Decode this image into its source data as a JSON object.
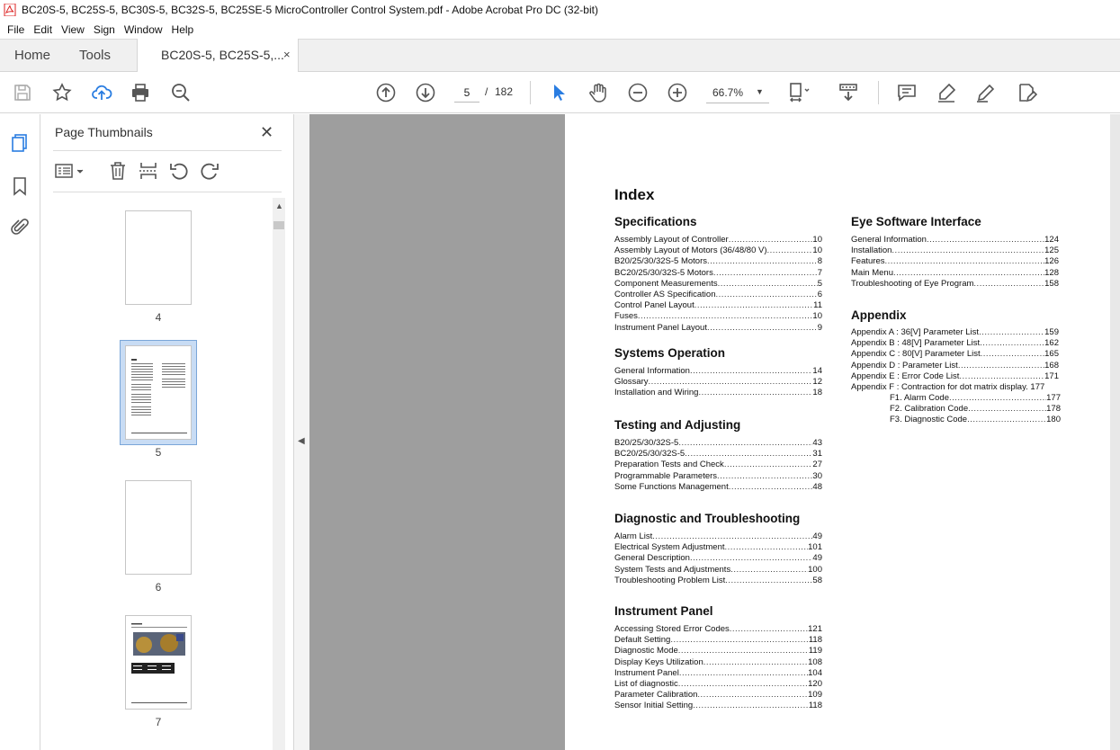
{
  "window": {
    "title": "BC20S-5, BC25S-5, BC30S-5, BC32S-5, BC25SE-5 MicroController Control System.pdf - Adobe Acrobat Pro DC (32-bit)"
  },
  "menu": [
    "File",
    "Edit",
    "View",
    "Sign",
    "Window",
    "Help"
  ],
  "tabs": {
    "home": "Home",
    "tools": "Tools",
    "doc": "BC20S-5, BC25S-5,...",
    "close": "×"
  },
  "toolbar": {
    "page_current": "5",
    "page_sep": "/",
    "page_total": "182",
    "zoom": "66.7%"
  },
  "thumbs": {
    "title": "Page Thumbnails",
    "pages": [
      {
        "num": "4"
      },
      {
        "num": "5"
      },
      {
        "num": "6"
      },
      {
        "num": "7"
      }
    ]
  },
  "doc": {
    "index_title": "Index",
    "left": [
      {
        "head": "Specifications",
        "entries": [
          [
            "Assembly Layout of Controller",
            "10"
          ],
          [
            "Assembly Layout of Motors (36/48/80 V)",
            "10"
          ],
          [
            "B20/25/30/32S-5 Motors",
            "8"
          ],
          [
            "BC20/25/30/32S-5 Motors",
            "7"
          ],
          [
            "Component Measurements",
            "5"
          ],
          [
            "Controller AS Specification",
            "6"
          ],
          [
            "Control Panel Layout",
            "11"
          ],
          [
            "Fuses",
            "10"
          ],
          [
            "Instrument Panel Layout",
            "9"
          ]
        ]
      },
      {
        "head": "Systems Operation",
        "entries": [
          [
            "General Information",
            "14"
          ],
          [
            "Glossary",
            "12"
          ],
          [
            "Installation and Wiring",
            "18"
          ]
        ]
      },
      {
        "head": "Testing and Adjusting",
        "entries": [
          [
            "B20/25/30/32S-5",
            "43"
          ],
          [
            "BC20/25/30/32S-5",
            "31"
          ],
          [
            "Preparation Tests and Check",
            "27"
          ],
          [
            "Programmable Parameters",
            "30"
          ],
          [
            "Some Functions Management",
            "48"
          ]
        ]
      },
      {
        "head": "Diagnostic and Troubleshooting",
        "entries": [
          [
            "Alarm List",
            "49"
          ],
          [
            "Electrical System Adjustment",
            "101"
          ],
          [
            "General Description",
            "49"
          ],
          [
            "System Tests and Adjustments",
            "100"
          ],
          [
            "Troubleshooting Problem List",
            "58"
          ]
        ]
      },
      {
        "head": "Instrument Panel",
        "entries": [
          [
            "Accessing Stored Error Codes",
            "121"
          ],
          [
            "Default Setting",
            "118"
          ],
          [
            "Diagnostic Mode",
            "119"
          ],
          [
            "Display Keys Utilization",
            "108"
          ],
          [
            "Instrument Panel",
            "104"
          ],
          [
            "List of diagnostic",
            "120"
          ],
          [
            "Parameter Calibration",
            "109"
          ],
          [
            "Sensor Initial Setting",
            "118"
          ]
        ]
      }
    ],
    "right": [
      {
        "head": "Eye Software Interface",
        "entries": [
          [
            "General Information",
            "124"
          ],
          [
            "Installation",
            "125"
          ],
          [
            "Features",
            "126"
          ],
          [
            "Main Menu",
            "128"
          ],
          [
            "Troubleshooting of Eye Program",
            "158"
          ]
        ]
      },
      {
        "head": "Appendix",
        "entries": [
          [
            "Appendix A : 36[V] Parameter List",
            "159"
          ],
          [
            "Appendix B : 48[V] Parameter List",
            "162"
          ],
          [
            "Appendix C : 80[V] Parameter List",
            "165"
          ],
          [
            "Appendix D : Parameter List",
            "168"
          ],
          [
            "Appendix E : Error Code List",
            "171"
          ]
        ]
      },
      {
        "appendix_f": "Appendix F : Contraction for dot matrix display. 177",
        "sub": [
          [
            "F1. Alarm Code",
            "177"
          ],
          [
            "F2. Calibration Code",
            "178"
          ],
          [
            "F3. Diagnostic Code",
            "180"
          ]
        ]
      }
    ]
  }
}
